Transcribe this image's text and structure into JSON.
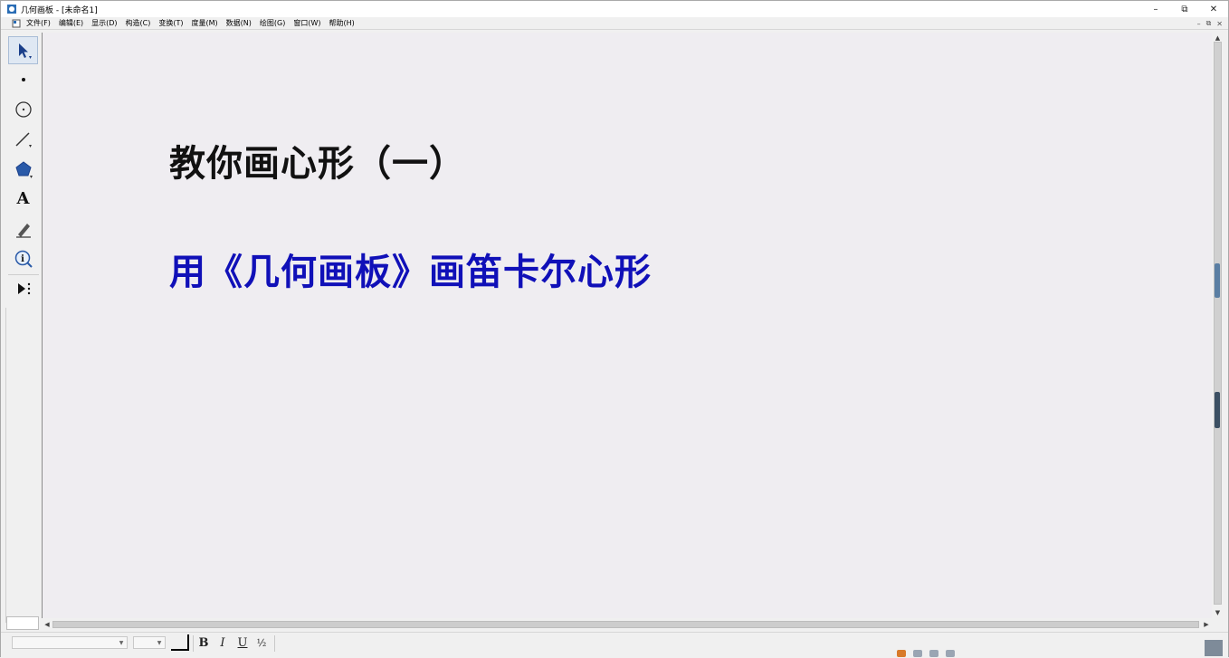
{
  "window": {
    "title": "几何画板 - [未命名1]",
    "controls": {
      "minimize": "–",
      "restore": "⧉",
      "close": "✕"
    }
  },
  "menubar": {
    "items": [
      {
        "label": "文件(F)"
      },
      {
        "label": "编辑(E)"
      },
      {
        "label": "显示(D)"
      },
      {
        "label": "构造(C)"
      },
      {
        "label": "变换(T)"
      },
      {
        "label": "度量(M)"
      },
      {
        "label": "数据(N)"
      },
      {
        "label": "绘图(G)"
      },
      {
        "label": "窗口(W)"
      },
      {
        "label": "帮助(H)"
      }
    ],
    "mdi_controls": {
      "minimize": "–",
      "restore": "⧉",
      "close": "✕"
    }
  },
  "toolbox": {
    "tools": [
      {
        "name": "selection-arrow-tool",
        "icon": "arrow-icon",
        "active": true
      },
      {
        "name": "point-tool",
        "icon": "point-icon"
      },
      {
        "name": "compass-tool",
        "icon": "circle-icon"
      },
      {
        "name": "straightedge-tool",
        "icon": "line-icon"
      },
      {
        "name": "polygon-tool",
        "icon": "polygon-icon"
      },
      {
        "name": "text-tool",
        "icon": "text-A-icon",
        "glyph": "A"
      },
      {
        "name": "marker-tool",
        "icon": "pen-icon"
      },
      {
        "name": "information-tool",
        "icon": "info-icon",
        "glyph": "i"
      },
      {
        "name": "custom-tool",
        "icon": "play-menu-icon"
      }
    ]
  },
  "canvas": {
    "title": "教你画心形（一）",
    "subtitle": "用《几何画板》画笛卡尔心形",
    "title_color": "#111111",
    "subtitle_color": "#1010b8",
    "background": "#efedf1"
  },
  "formatbar": {
    "font_value": "",
    "size_value": "",
    "bold_label": "B",
    "italic_label": "I",
    "underline_label": "U",
    "fraction_label": "½"
  }
}
